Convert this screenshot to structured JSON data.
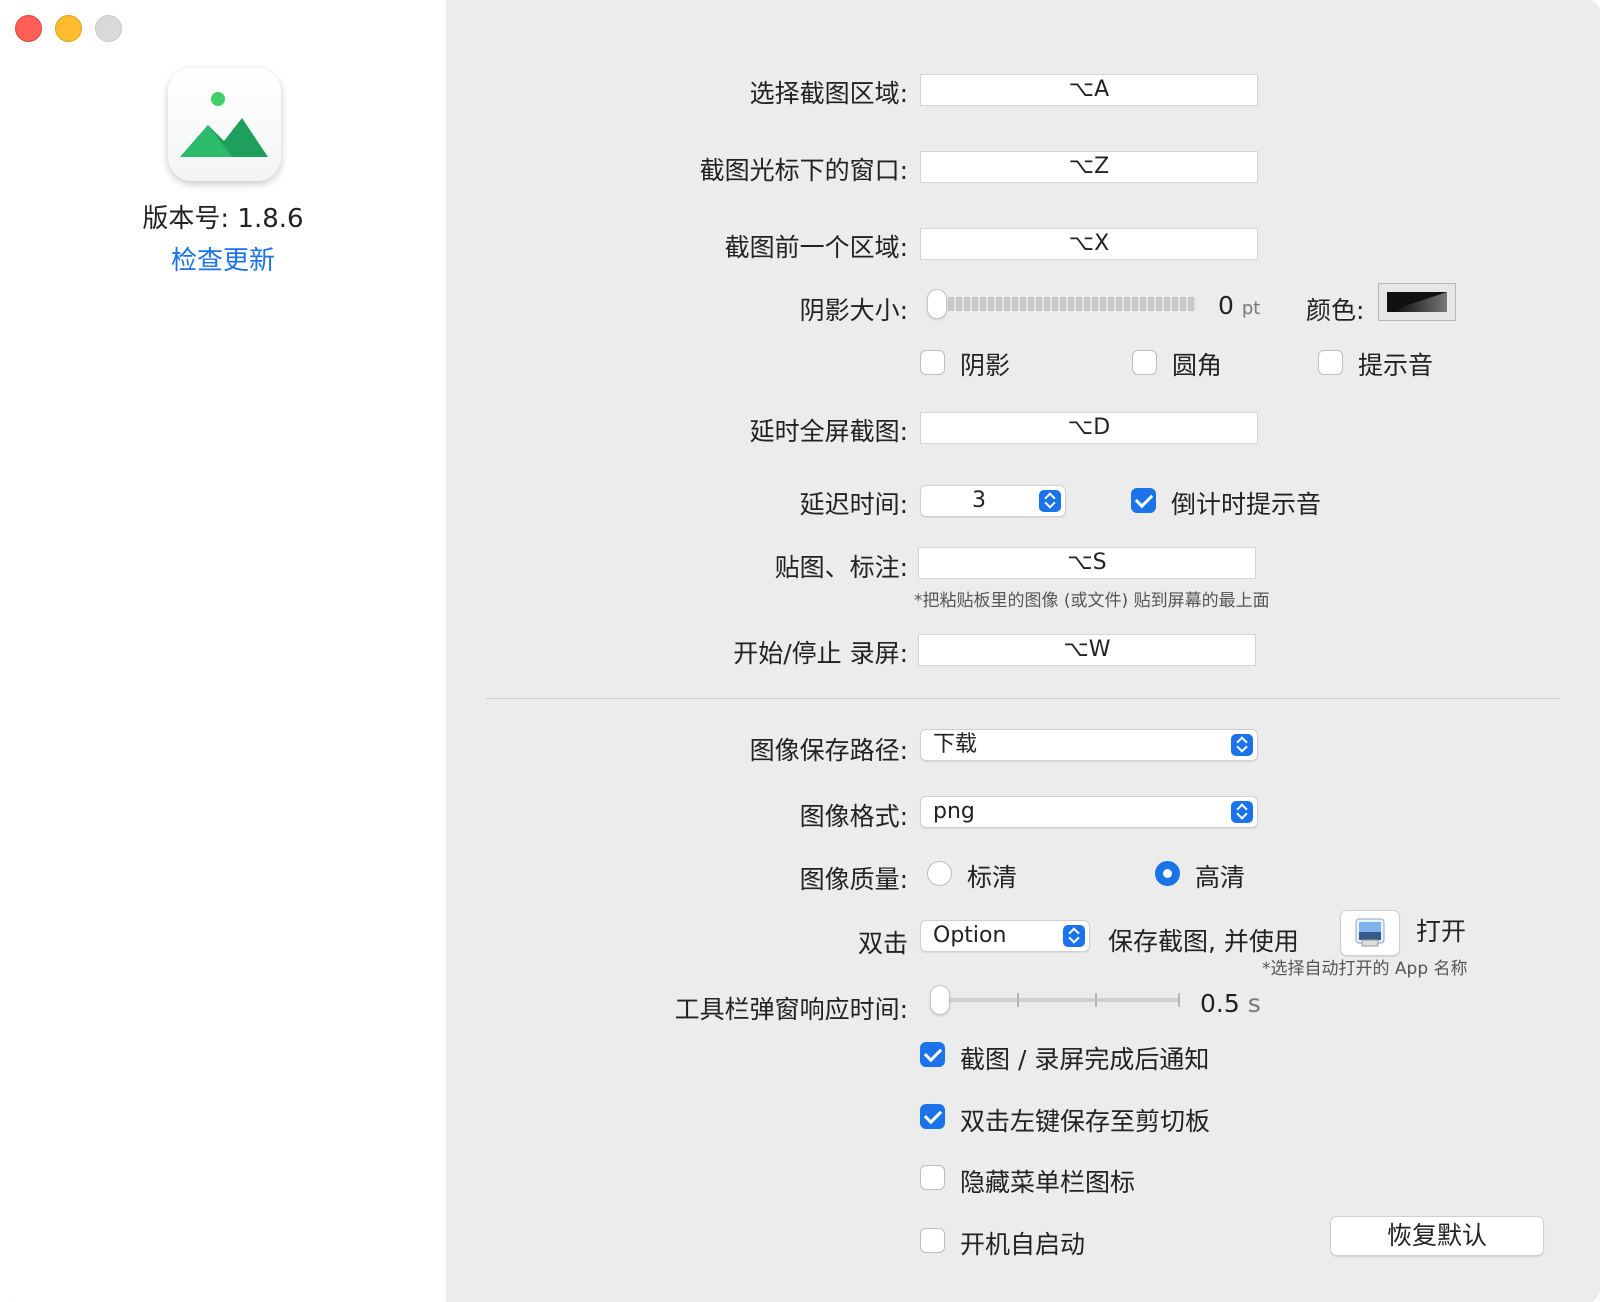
{
  "window": {
    "traffic_lights": [
      "close",
      "minimize",
      "zoom"
    ]
  },
  "sidebar": {
    "app_icon": "landscape-photo-icon",
    "version": "版本号: 1.8.6",
    "check_update": "检查更新"
  },
  "shortcuts": {
    "select_area_label": "选择截图区域:",
    "select_area_value": "⌥A",
    "window_under_cursor_label": "截图光标下的窗口:",
    "window_under_cursor_value": "⌥Z",
    "previous_area_label": "截图前一个区域:",
    "previous_area_value": "⌥X",
    "shadow_size_label": "阴影大小:",
    "shadow_size_value": "0",
    "shadow_size_unit": "pt",
    "shadow_size_fraction": 0,
    "color_label": "颜色:",
    "shadow_checkbox": "阴影",
    "rounded_checkbox": "圆角",
    "sound_checkbox": "提示音",
    "delayed_fullscreen_label": "延时全屏截图:",
    "delayed_fullscreen_value": "⌥D",
    "delay_time_label": "延迟时间:",
    "delay_time_value": "3",
    "countdown_sound_checkbox": "倒计时提示音",
    "pin_label": "贴图、标注:",
    "pin_value": "⌥S",
    "pin_note": "*把粘贴板里的图像 (或文件) 贴到屏幕的最上面",
    "record_label": "开始/停止 录屏:",
    "record_value": "⌥W"
  },
  "settings": {
    "save_path_label": "图像保存路径:",
    "save_path_value": "下载",
    "format_label": "图像格式:",
    "format_value": "png",
    "quality_label": "图像质量:",
    "quality_sd": "标清",
    "quality_hd": "高清",
    "double_click_label": "双击",
    "double_click_key": "Option",
    "double_click_action": "保存截图, 并使用",
    "open_label": "打开",
    "open_note": "*选择自动打开的 App 名称",
    "toolbar_delay_label": "工具栏弹窗响应时间:",
    "toolbar_delay_value": "0.5",
    "toolbar_delay_unit": "s",
    "notify_checkbox": "截图 / 录屏完成后通知",
    "double_click_copy_checkbox": "双击左键保存至剪切板",
    "hide_menubar_checkbox": "隐藏菜单栏图标",
    "launch_at_login_checkbox": "开机自启动",
    "restore_defaults": "恢复默认"
  },
  "state": {
    "shadow": false,
    "rounded": false,
    "sound": false,
    "countdown_sound": true,
    "quality": "高清",
    "notify": true,
    "double_click_copy": true,
    "hide_menubar": false,
    "launch_at_login": false
  },
  "colors": {
    "accent": "#1a73e8",
    "background": "#ececec",
    "sidebar": "#ffffff"
  }
}
